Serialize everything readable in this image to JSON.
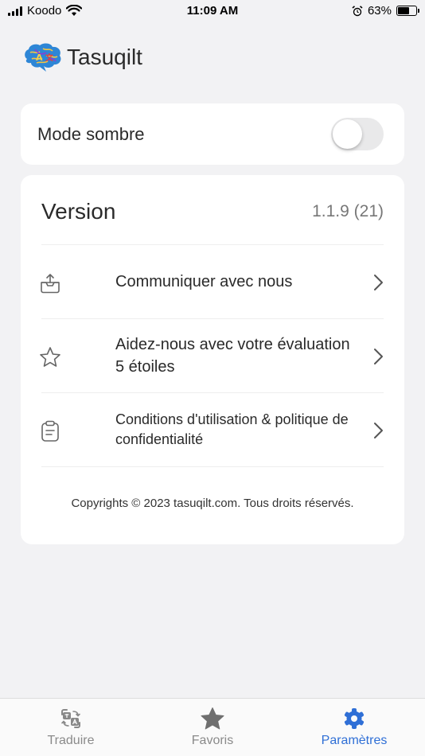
{
  "status_bar": {
    "carrier": "Koodo",
    "time": "11:09 AM",
    "battery_percent": "63%",
    "battery_level": 0.63,
    "icons": [
      "signal-icon",
      "wifi-icon",
      "alarm-icon",
      "battery-icon"
    ]
  },
  "header": {
    "logo_icon": "brain-logo-icon",
    "title": "Tasuqilt"
  },
  "dark_mode": {
    "label": "Mode sombre",
    "enabled": false
  },
  "version": {
    "label": "Version",
    "value": "1.1.9 (21)"
  },
  "menu": [
    {
      "icon": "inbox-upload-icon",
      "label": "Communiquer avec nous"
    },
    {
      "icon": "star-outline-icon",
      "label": "Aidez-nous avec votre évaluation 5 étoiles"
    },
    {
      "icon": "clipboard-icon",
      "label": "Conditions d'utilisation & politique de confidentialité"
    }
  ],
  "footer": {
    "copyright": "Copyrights © 2023 tasuqilt.com. Tous droits réservés."
  },
  "tabbar": {
    "tabs": [
      {
        "icon": "translate-icon",
        "label": "Traduire",
        "active": false
      },
      {
        "icon": "star-filled-icon",
        "label": "Favoris",
        "active": false
      },
      {
        "icon": "gear-icon",
        "label": "Paramètres",
        "active": true
      }
    ],
    "colors": {
      "active": "#2f6fd6",
      "inactive": "#8a8a8a"
    }
  }
}
